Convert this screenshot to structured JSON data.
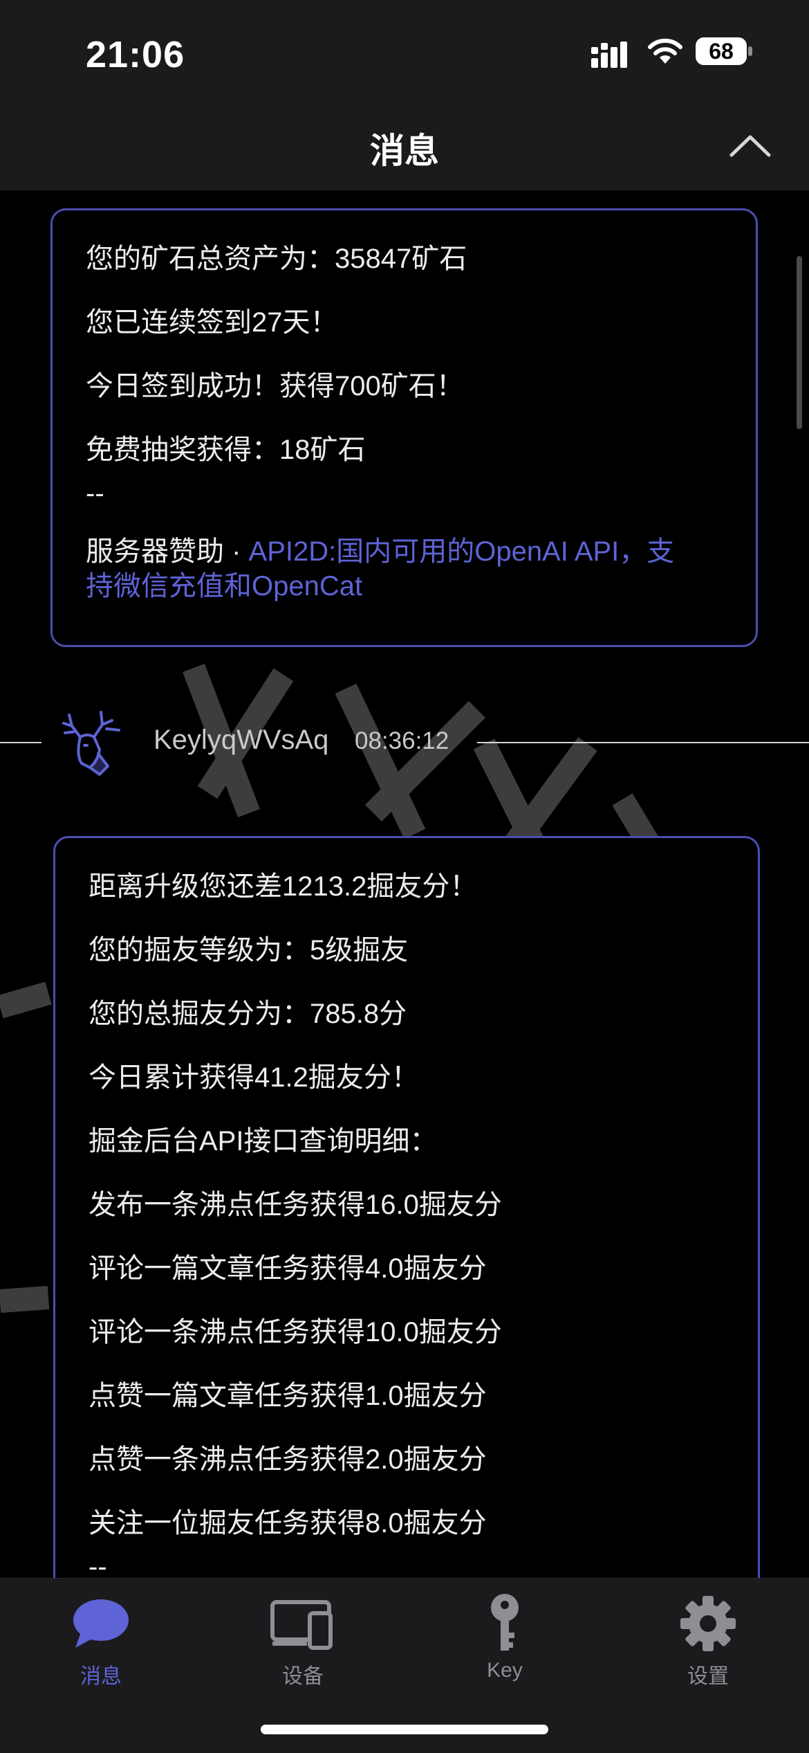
{
  "status_bar": {
    "time": "21:06",
    "battery": "68"
  },
  "header": {
    "title": "消息"
  },
  "messages": [
    {
      "lines": [
        "您的矿石总资产为：35847矿石",
        "您已连续签到27天！",
        "今日签到成功！获得700矿石！",
        "免费抽奖获得：18矿石"
      ],
      "separator": "--",
      "footer_prefix": "服务器赞助 · ",
      "footer_link_1": "API2D:国内可用的OpenAI API，支",
      "footer_link_2": "持微信充值和OpenCat"
    },
    {
      "sender": "KeylyqWVsAq",
      "time": "08:36:12",
      "lines": [
        "距离升级您还差1213.2掘友分！",
        "您的掘友等级为：5级掘友",
        "您的总掘友分为：785.8分",
        "今日累计获得41.2掘友分！",
        "掘金后台API接口查询明细：",
        "发布一条沸点任务获得16.0掘友分",
        "评论一篇文章任务获得4.0掘友分",
        "评论一条沸点任务获得10.0掘友分",
        "点赞一篇文章任务获得1.0掘友分",
        "点赞一条沸点任务获得2.0掘友分",
        "关注一位掘友任务获得8.0掘友分"
      ],
      "separator": "--"
    }
  ],
  "tabs": [
    {
      "label": "消息",
      "icon": "chat-bubble-icon",
      "active": true
    },
    {
      "label": "设备",
      "icon": "devices-icon",
      "active": false
    },
    {
      "label": "Key",
      "icon": "key-icon",
      "active": false
    },
    {
      "label": "设置",
      "icon": "gear-icon",
      "active": false
    }
  ],
  "colors": {
    "accent": "#5e63d6",
    "card_border": "#4a4fb0",
    "bar_bg": "#1b1b1d"
  }
}
